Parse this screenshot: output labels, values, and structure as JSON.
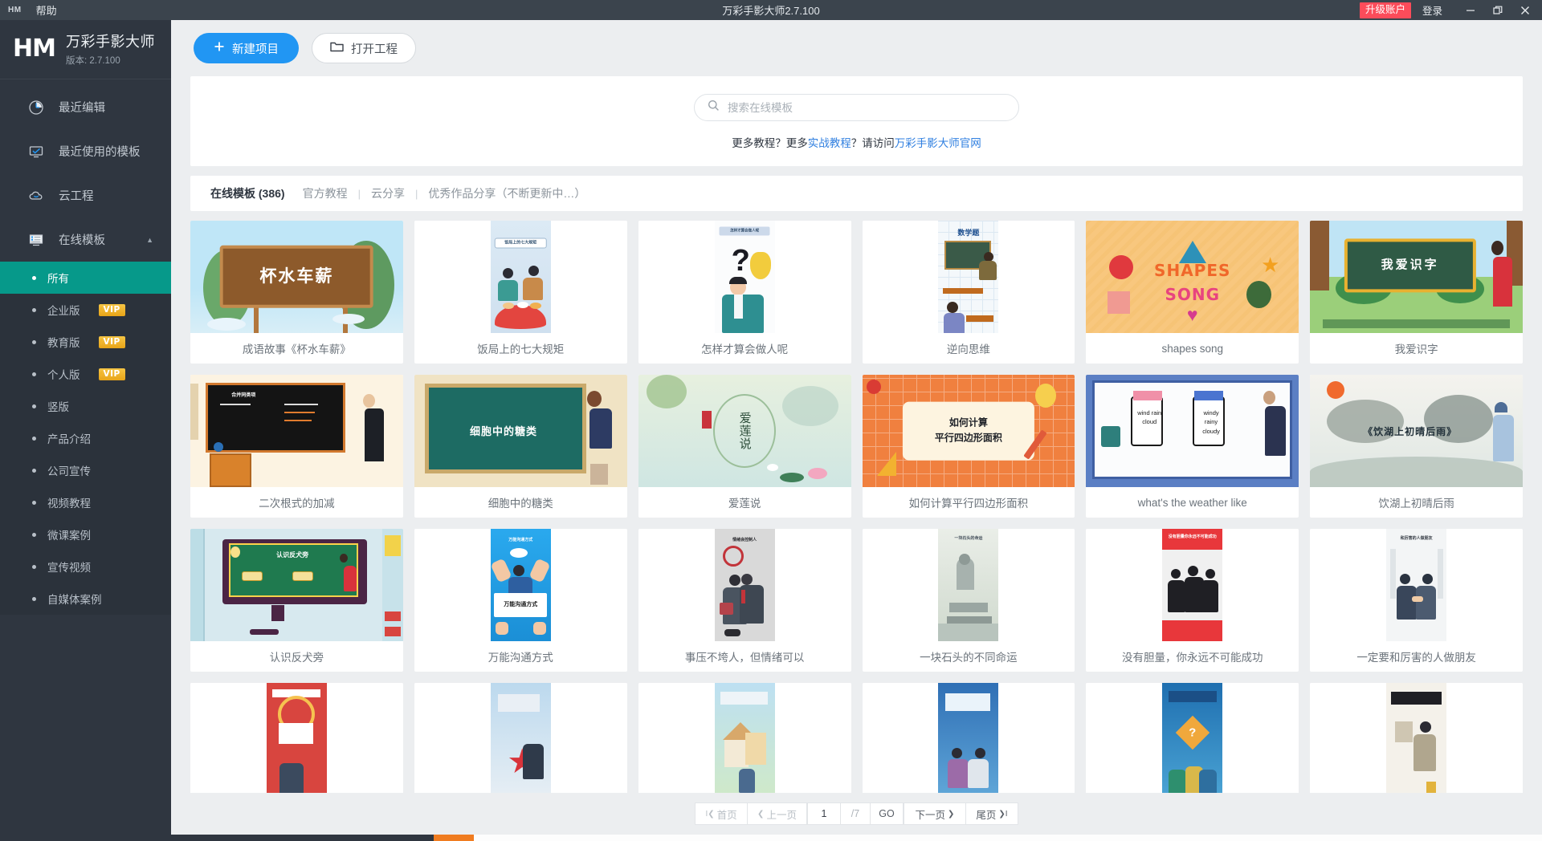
{
  "titlebar": {
    "logo_mini": "HM",
    "menu_help": "帮助",
    "title": "万彩手影大师2.7.100",
    "upgrade": "升级账户",
    "login": "登录",
    "minimize": "—",
    "restore": "❐",
    "close": "✕"
  },
  "sidebar": {
    "logo": "HM",
    "app_name": "万彩手影大师",
    "version": "版本: 2.7.100",
    "nav": [
      {
        "label": "最近编辑",
        "icon": "clock-icon"
      },
      {
        "label": "最近使用的模板",
        "icon": "monitor-check-icon"
      },
      {
        "label": "云工程",
        "icon": "cloud-icon"
      },
      {
        "label": "在线模板",
        "icon": "template-icon",
        "caret": "▲",
        "expanded": true
      }
    ],
    "sub_items": [
      {
        "label": "所有",
        "active": true,
        "vip": false
      },
      {
        "label": "企业版",
        "active": false,
        "vip": true,
        "vip_label": "VIP"
      },
      {
        "label": "教育版",
        "active": false,
        "vip": true,
        "vip_label": "VIP"
      },
      {
        "label": "个人版",
        "active": false,
        "vip": true,
        "vip_label": "VIP"
      },
      {
        "label": "竖版",
        "active": false,
        "vip": false
      },
      {
        "label": "产品介绍",
        "active": false,
        "vip": false
      },
      {
        "label": "公司宣传",
        "active": false,
        "vip": false
      },
      {
        "label": "视频教程",
        "active": false,
        "vip": false
      },
      {
        "label": "微课案例",
        "active": false,
        "vip": false
      },
      {
        "label": "宣传视频",
        "active": false,
        "vip": false
      },
      {
        "label": "自媒体案例",
        "active": false,
        "vip": false
      }
    ]
  },
  "toolbar": {
    "new_project": "新建项目",
    "new_project_icon": "plus-icon",
    "open_project": "打开工程",
    "open_project_icon": "folder-icon"
  },
  "search": {
    "placeholder": "搜索在线模板",
    "icon": "search-icon",
    "tutorial_prefix": "更多教程？更多",
    "tutorial_link1": "实战教程",
    "tutorial_mid": "？请访问",
    "tutorial_link2": "万彩手影大师官网"
  },
  "tabs": [
    {
      "label": "在线模板 (386)",
      "active": true
    },
    {
      "label": "官方教程",
      "active": false
    },
    {
      "label": "云分享",
      "active": false
    },
    {
      "label": "优秀作品分享（不断更新中…）",
      "active": false
    }
  ],
  "tab_separator": "|",
  "templates": [
    {
      "label": "成语故事《杯水车薪》",
      "orient": "land",
      "art": "cheng-yu-sign"
    },
    {
      "label": "饭局上的七大规矩",
      "orient": "port",
      "art": "banquet"
    },
    {
      "label": "怎样才算会做人呢",
      "orient": "port",
      "art": "question-man"
    },
    {
      "label": "逆向思维",
      "orient": "port",
      "art": "math-class"
    },
    {
      "label": "shapes song",
      "orient": "land",
      "art": "shapes-song"
    },
    {
      "label": "我爱识字",
      "orient": "land",
      "art": "blackboard-outdoor"
    },
    {
      "label": "二次根式的加减",
      "orient": "land",
      "art": "classroom-teacher"
    },
    {
      "label": "细胞中的糖类",
      "orient": "land",
      "art": "green-board"
    },
    {
      "label": "爱莲说",
      "orient": "land",
      "art": "lotus-ink"
    },
    {
      "label": "如何计算平行四边形面积",
      "orient": "land",
      "art": "parallelogram"
    },
    {
      "label": "what's the weather like",
      "orient": "land",
      "art": "weather-board"
    },
    {
      "label": "饮湖上初晴后雨",
      "orient": "land",
      "art": "ink-mountain"
    },
    {
      "label": "认识反犬旁",
      "orient": "land",
      "art": "monitor-lesson"
    },
    {
      "label": "万能沟通方式",
      "orient": "port",
      "art": "blue-communication"
    },
    {
      "label": "事压不垮人，但情绪可以",
      "orient": "port",
      "art": "grey-office"
    },
    {
      "label": "一块石头的不同命运",
      "orient": "port",
      "art": "stone-fate"
    },
    {
      "label": "没有胆量，你永远不可能成功",
      "orient": "port",
      "art": "red-courage"
    },
    {
      "label": "一定要和厉害的人做朋友",
      "orient": "port",
      "art": "handshake"
    },
    {
      "label": "",
      "orient": "port",
      "art": "row4-a"
    },
    {
      "label": "",
      "orient": "port",
      "art": "row4-b"
    },
    {
      "label": "",
      "orient": "port",
      "art": "row4-c"
    },
    {
      "label": "",
      "orient": "port",
      "art": "row4-d"
    },
    {
      "label": "",
      "orient": "port",
      "art": "row4-e"
    },
    {
      "label": "",
      "orient": "port",
      "art": "row4-f"
    }
  ],
  "template_art_text": {
    "cheng-yu-sign": "杯水车薪",
    "banquet": "饭局上的七大规矩",
    "question-man": "怎样才算会做人呢",
    "math-class": "数学题",
    "shapes-song-1": "SHAPES",
    "shapes-song-2": "SONG",
    "blackboard-outdoor": "我爱识字",
    "classroom-teacher": "合并同类项",
    "green-board": "细胞中的糖类",
    "lotus-ink": "爱莲说",
    "parallelogram-1": "如何计算",
    "parallelogram-2": "平行四边形面积",
    "weather-1": "wind rain cloud",
    "weather-2": "windy rainy cloudy",
    "ink-mountain": "《饮湖上初晴后雨》",
    "monitor-lesson": "认识反犬旁",
    "blue-communication": "万能沟通方式",
    "grey-office": "情绪会控制人",
    "stone-fate": "一块石头的命运",
    "red-courage": "没有胆量你永远不可能成功",
    "handshake": "和厉害的人做朋友"
  },
  "pagination": {
    "first": "首页",
    "first_icon": "first-page-icon",
    "prev": "上一页",
    "prev_icon": "chevron-left-icon",
    "current_page": "1",
    "total_pages": "/7",
    "go": "GO",
    "next": "下一页",
    "next_icon": "chevron-right-icon",
    "last": "尾页",
    "last_icon": "last-page-icon"
  },
  "colors": {
    "accent_blue": "#2196f3",
    "sidebar_bg": "#2f3640",
    "active_green": "#06998a",
    "upgrade_red": "#fc4c5a",
    "link_blue": "#2f7fe0",
    "vip_gold": "#e8a417"
  }
}
